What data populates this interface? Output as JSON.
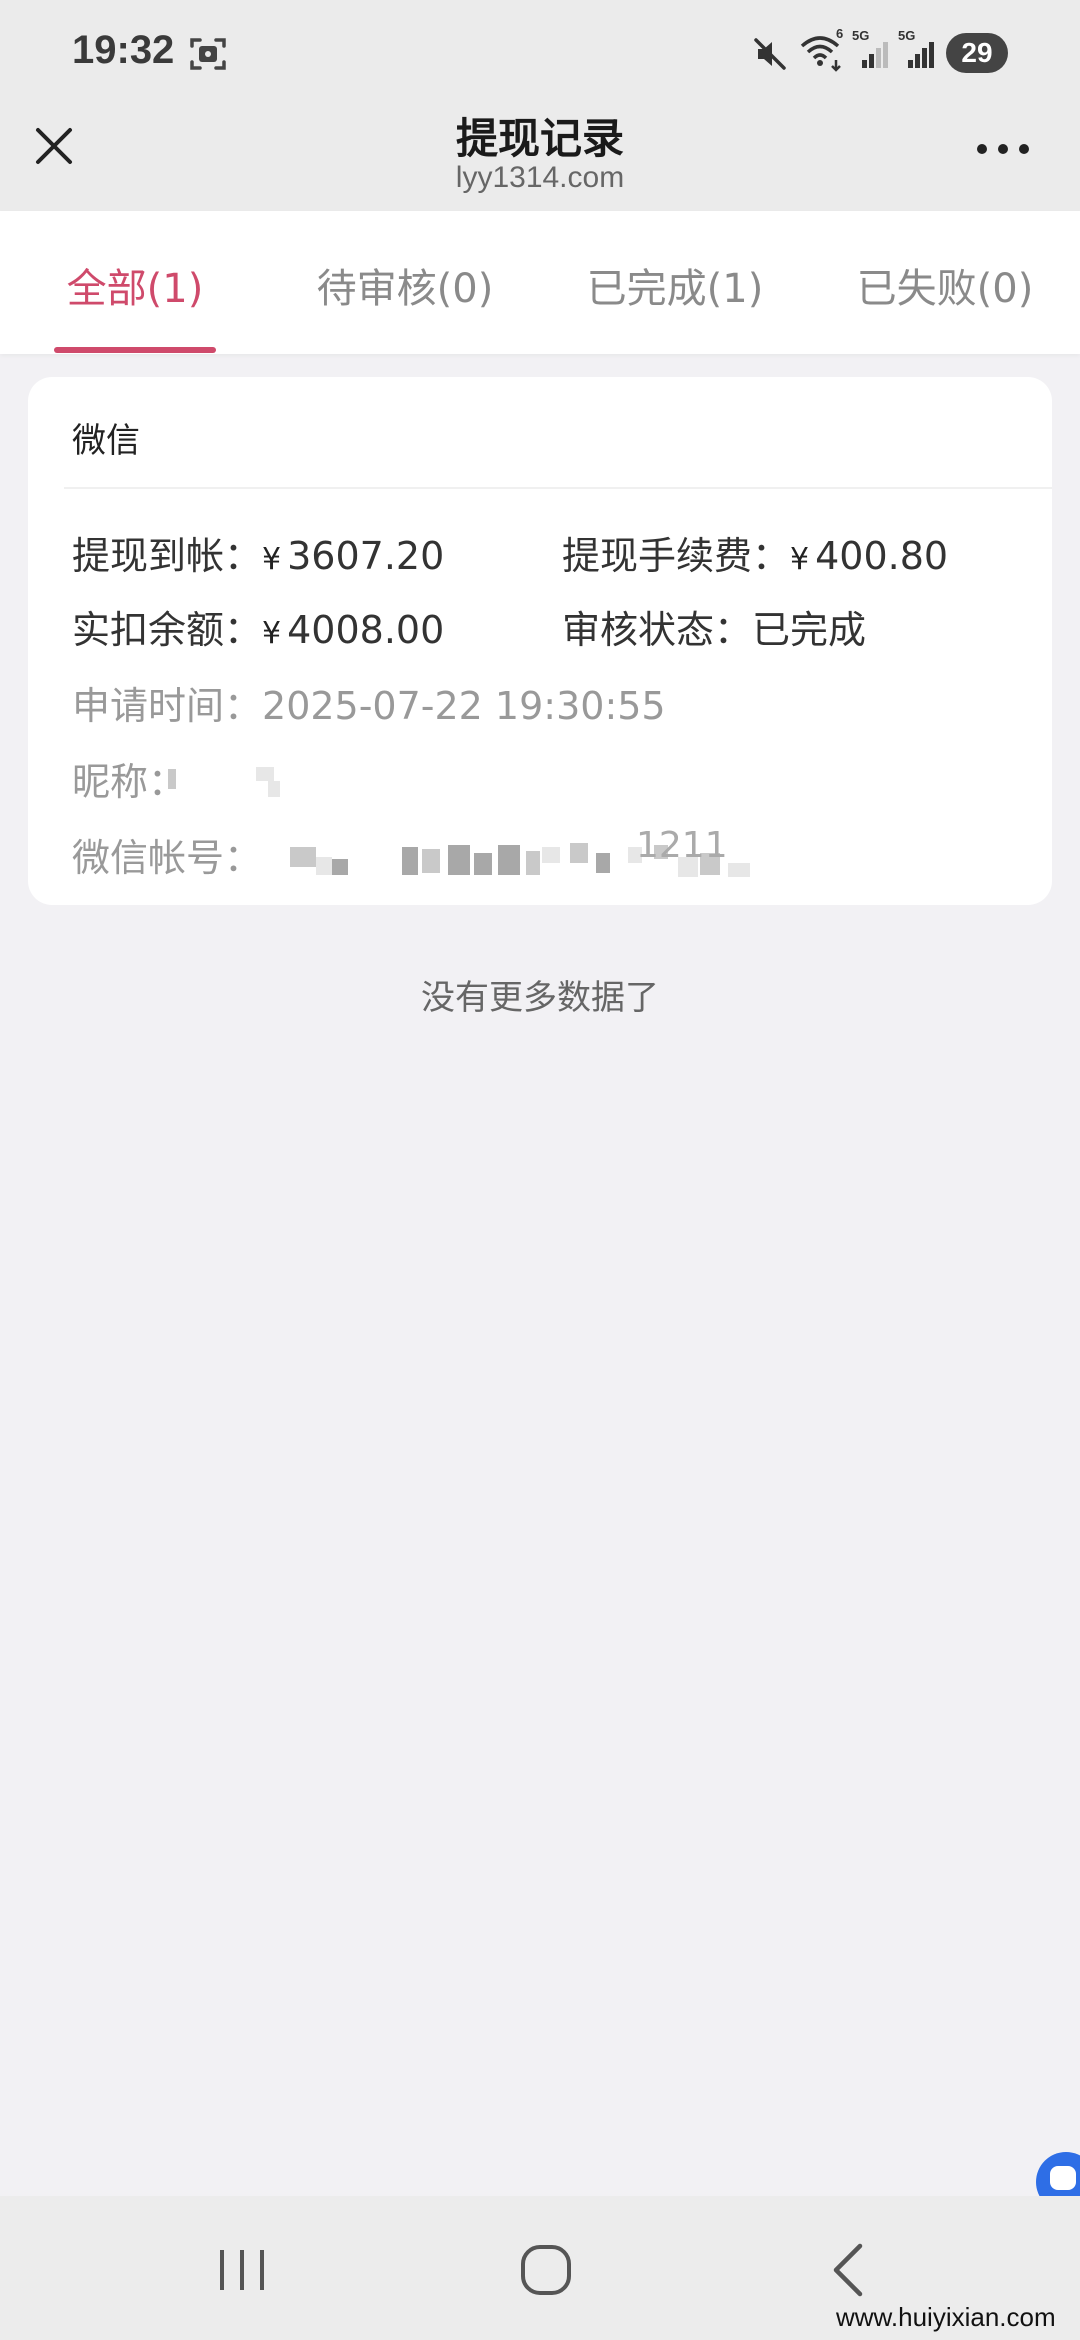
{
  "status_bar": {
    "time": "19:32",
    "net_label_1": "5G",
    "net_label_2": "5G",
    "wifi_label": "6",
    "battery": "29"
  },
  "header": {
    "title": "提现记录",
    "subtitle": "lyy1314.com"
  },
  "tabs": [
    {
      "label": "全部(1)",
      "active": true
    },
    {
      "label": "待审核(0)",
      "active": false
    },
    {
      "label": "已完成(1)",
      "active": false
    },
    {
      "label": "已失败(0)",
      "active": false
    }
  ],
  "record": {
    "channel": "微信",
    "arrived_label": "提现到帐：",
    "arrived_currency": "¥",
    "arrived_value": "3607.20",
    "fee_label": "提现手续费：",
    "fee_currency": "¥",
    "fee_value": "400.80",
    "deducted_label": "实扣余额：",
    "deducted_currency": "¥",
    "deducted_value": "4008.00",
    "status_label": "审核状态：",
    "status_value": "已完成",
    "time_label": "申请时间：",
    "time_value": "2025-07-22 19:30:55",
    "nickname_label": "昵称：",
    "account_label": "微信帐号：",
    "account_visible_tail": "1211"
  },
  "list_footer": "没有更多数据了",
  "watermark": "www.huiyixian.com",
  "colors": {
    "accent": "#cf4a6b",
    "page_bg": "#f2f1f4",
    "bar_bg": "#ebebeb",
    "bubble": "#2e6ee6"
  },
  "icons": [
    "screenshot-icon",
    "mute-icon",
    "wifi-icon",
    "signal-icon",
    "close-icon",
    "more-icon",
    "recent-apps-icon",
    "home-icon",
    "back-icon"
  ]
}
